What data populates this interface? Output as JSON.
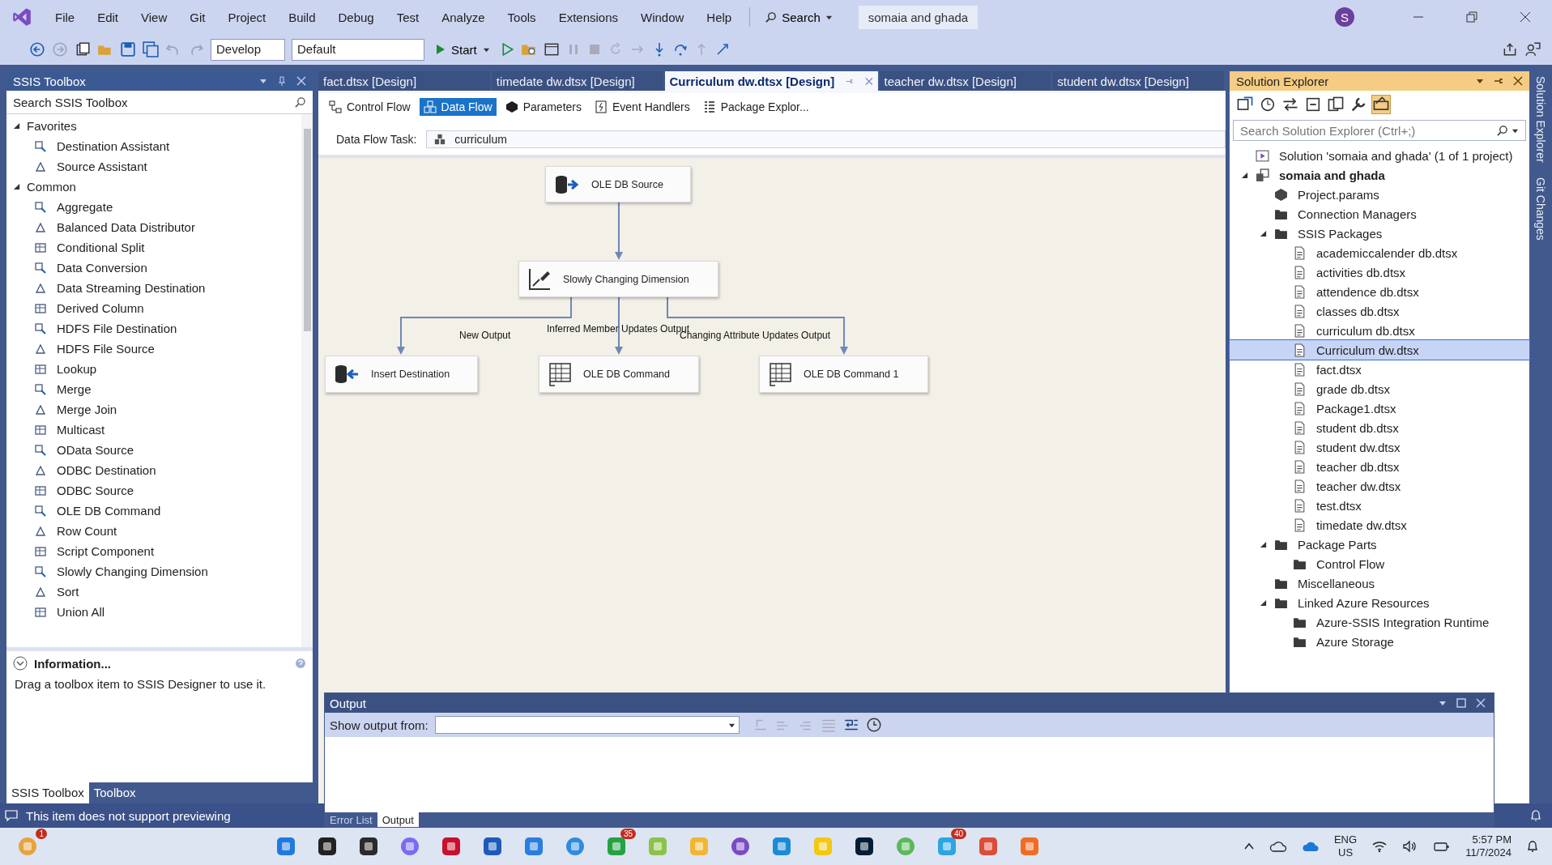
{
  "menu": [
    "File",
    "Edit",
    "View",
    "Git",
    "Project",
    "Build",
    "Debug",
    "Test",
    "Analyze",
    "Tools",
    "Extensions",
    "Window",
    "Help"
  ],
  "search": {
    "label": "Search"
  },
  "solution_name": "somaia and ghada",
  "user_initial": "S",
  "toolbar": {
    "configuration": "Develop",
    "platform": "Default",
    "start": "Start"
  },
  "toolbox": {
    "title": "SSIS Toolbox",
    "search": {
      "placeholder": "Search SSIS Toolbox"
    },
    "groups": [
      {
        "label": "Favorites",
        "expanded": true,
        "children": [
          "Destination Assistant",
          "Source Assistant"
        ]
      },
      {
        "label": "Common",
        "expanded": true,
        "children": [
          "Aggregate",
          "Balanced Data Distributor",
          "Conditional Split",
          "Data Conversion",
          "Data Streaming Destination",
          "Derived Column",
          "HDFS File Destination",
          "HDFS File Source",
          "Lookup",
          "Merge",
          "Merge Join",
          "Multicast",
          "OData Source",
          "ODBC Destination",
          "ODBC Source",
          "OLE DB Command",
          "Row Count",
          "Script Component",
          "Slowly Changing Dimension",
          "Sort",
          "Union All"
        ]
      }
    ],
    "info": {
      "title": "Information...",
      "text": "Drag a toolbox item to SSIS Designer to use it."
    },
    "bottom_tabs": [
      {
        "label": "SSIS Toolbox",
        "selected": true
      },
      {
        "label": "Toolbox",
        "selected": false
      }
    ]
  },
  "document_tabs": [
    {
      "label": "fact.dtsx [Design]",
      "selected": false
    },
    {
      "label": "timedate dw.dtsx [Design]",
      "selected": false
    },
    {
      "label": "Curriculum dw.dtsx [Design]",
      "selected": true
    },
    {
      "label": "teacher dw.dtsx [Design]",
      "selected": false
    },
    {
      "label": "student dw.dtsx [Design]",
      "selected": false
    }
  ],
  "designer_tabs": [
    {
      "label": "Control Flow",
      "selected": false
    },
    {
      "label": "Data Flow",
      "selected": true
    },
    {
      "label": "Parameters",
      "selected": false
    },
    {
      "label": "Event Handlers",
      "selected": false
    },
    {
      "label": "Package Explor...",
      "selected": false
    }
  ],
  "data_flow_task": {
    "label": "Data Flow Task:",
    "value": "curriculum"
  },
  "canvas": {
    "nodes": [
      {
        "label": "OLE DB Source",
        "kind": "source"
      },
      {
        "label": "Slowly Changing Dimension",
        "kind": "scd"
      },
      {
        "label": "Insert Destination",
        "kind": "destination"
      },
      {
        "label": "OLE DB Command",
        "kind": "command"
      },
      {
        "label": "OLE DB Command 1",
        "kind": "command"
      }
    ],
    "paths": [
      {
        "label": "New Output"
      },
      {
        "label": "Inferred Member Updates Output"
      },
      {
        "label": "Changing Attribute Updates Output"
      }
    ]
  },
  "output": {
    "title": "Output",
    "show_from_label": "Show output from:",
    "tabs": [
      {
        "label": "Error List",
        "selected": false
      },
      {
        "label": "Output",
        "selected": true
      }
    ]
  },
  "status_bar": "This item does not support previewing",
  "solution_explorer": {
    "title": "Solution Explorer",
    "search": {
      "placeholder": "Search Solution Explorer (Ctrl+;)"
    },
    "tree": [
      {
        "label": "Solution 'somaia and ghada' (1 of 1 project)",
        "kind": "solution",
        "selected": false
      },
      {
        "label": "somaia and ghada",
        "kind": "project",
        "selected": false,
        "expanded": true,
        "children": [
          {
            "label": "Project.params",
            "kind": "params",
            "selected": false
          },
          {
            "label": "Connection Managers",
            "kind": "folder",
            "selected": false
          },
          {
            "label": "SSIS Packages",
            "kind": "folder",
            "selected": false,
            "expanded": true,
            "children": [
              {
                "label": "academiccalender db.dtsx",
                "kind": "file",
                "selected": false
              },
              {
                "label": "activities db.dtsx",
                "kind": "file",
                "selected": false
              },
              {
                "label": "attendence db.dtsx",
                "kind": "file",
                "selected": false
              },
              {
                "label": "classes db.dtsx",
                "kind": "file",
                "selected": false
              },
              {
                "label": "curriculum db.dtsx",
                "kind": "file",
                "selected": false
              },
              {
                "label": "Curriculum dw.dtsx",
                "kind": "file",
                "selected": true
              },
              {
                "label": "fact.dtsx",
                "kind": "file",
                "selected": false
              },
              {
                "label": "grade db.dtsx",
                "kind": "file",
                "selected": false
              },
              {
                "label": "Package1.dtsx",
                "kind": "file",
                "selected": false
              },
              {
                "label": "student db.dtsx",
                "kind": "file",
                "selected": false
              },
              {
                "label": "student dw.dtsx",
                "kind": "file",
                "selected": false
              },
              {
                "label": "teacher db.dtsx",
                "kind": "file",
                "selected": false
              },
              {
                "label": "teacher dw.dtsx",
                "kind": "file",
                "selected": false
              },
              {
                "label": "test.dtsx",
                "kind": "file",
                "selected": false
              },
              {
                "label": "timedate dw.dtsx",
                "kind": "file",
                "selected": false
              }
            ]
          },
          {
            "label": "Package Parts",
            "kind": "folder",
            "selected": false,
            "expanded": true,
            "children": [
              {
                "label": "Control Flow",
                "kind": "folder",
                "selected": false
              }
            ]
          },
          {
            "label": "Miscellaneous",
            "kind": "folder",
            "selected": false
          },
          {
            "label": "Linked Azure Resources",
            "kind": "folder",
            "selected": false,
            "expanded": true,
            "children": [
              {
                "label": "Azure-SSIS Integration Runtime",
                "kind": "folder",
                "selected": false
              },
              {
                "label": "Azure Storage",
                "kind": "folder",
                "selected": false
              }
            ]
          }
        ]
      }
    ]
  },
  "side_tabs": [
    "Solution Explorer",
    "Git Changes"
  ],
  "taskbar": {
    "apps": [
      {
        "color": "#e8a33d",
        "badge": "1"
      },
      {
        "color": "#1f7ae0"
      },
      {
        "color": "#222222"
      },
      {
        "color": "#2b2b2b"
      },
      {
        "color": "#7a6cf0"
      },
      {
        "color": "#c8102e"
      },
      {
        "color": "#1e5bb8"
      },
      {
        "color": "#2a7de1"
      },
      {
        "color": "#2f8be0"
      },
      {
        "color": "#25a244",
        "badge": "35"
      },
      {
        "color": "#8bc34a"
      },
      {
        "color": "#f2b632"
      },
      {
        "color": "#7b4bc4"
      },
      {
        "color": "#1c8bd6"
      },
      {
        "color": "#f2c811"
      },
      {
        "color": "#001e36"
      },
      {
        "color": "#5cb85c"
      },
      {
        "color": "#2ca5e0",
        "badge": "40"
      },
      {
        "color": "#dd4b39"
      },
      {
        "color": "#f26b21"
      }
    ],
    "language": [
      "ENG",
      "US"
    ],
    "time": "5:57 PM",
    "date": "11/7/2024"
  }
}
